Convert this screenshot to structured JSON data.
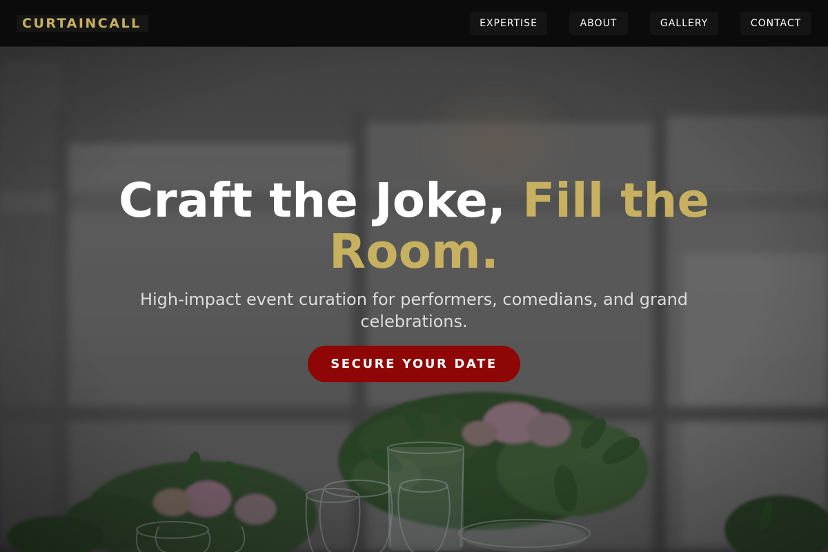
{
  "brand": {
    "name": "CURTAINCALL"
  },
  "nav": {
    "items": [
      {
        "label": "EXPERTISE"
      },
      {
        "label": "ABOUT"
      },
      {
        "label": "GALLERY"
      },
      {
        "label": "CONTACT"
      }
    ]
  },
  "hero": {
    "headline_white": "Craft the Joke, ",
    "headline_gold": "Fill the Room.",
    "subtitle": "High-impact event curation for performers, comedians, and grand celebrations.",
    "cta_label": "SECURE YOUR DATE",
    "background_image": "event-table-photo"
  },
  "colors": {
    "navbar_bg": "#0b0b0b",
    "brand_gold": "#c7b160",
    "cta_red": "#8f0606",
    "text_white": "#ffffff",
    "subtitle_gray": "#dcdcdc"
  }
}
